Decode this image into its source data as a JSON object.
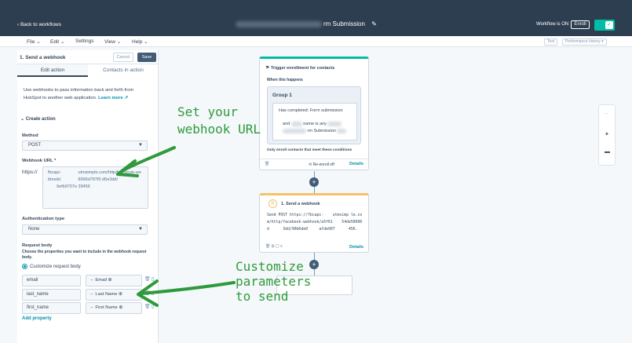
{
  "topbar": {
    "back": "‹ Back to workflows",
    "title": "rm Submission",
    "edit_icon": "✎",
    "status": "Workflow is ON",
    "enroll": "Enroll",
    "toggle_check": "✓"
  },
  "menubar": {
    "file": "File ⌄",
    "edit": "Edit ⌄",
    "settings": "Settings",
    "view": "View ⌄",
    "help": "Help ⌄",
    "test": "Test",
    "performance": "Performance history ▾"
  },
  "panel": {
    "title": "1. Send a webhook",
    "cancel": "Cancel",
    "save": "Save",
    "tab_edit": "Edit action",
    "tab_contacts": "Contacts in action",
    "description": "Use webhooks to pass information back and forth from HubSpot to another web application.",
    "learn_more": "Learn more ↗",
    "create_action": "⌄  Create action",
    "method_label": "Method",
    "method_value": "POST",
    "url_label": "Webhook URL *",
    "url_prefix": "https://",
    "url_value": "fbcapi-    utmsimple.com/http/facebook-webhook/    8996d787f0 d5e3dd/       9efb9707e 39456",
    "auth_label": "Authentication type",
    "auth_value": "None",
    "request_body_label": "Request body",
    "request_body_hint": "Choose the properties you want to include in the webhook request body.",
    "customize_label": "Customize request body",
    "rows": [
      {
        "key": "email",
        "value": "⇔ Email ⊕"
      },
      {
        "key": "last_name",
        "value": "⇔ Last Name ⊕"
      },
      {
        "key": "first_name",
        "value": "⇔ First Name ⊕"
      }
    ],
    "add_property": "Add property"
  },
  "trigger": {
    "heading": "Trigger enrollment for contacts",
    "when": "When this happens",
    "group_title": "Group 1",
    "condition": "Has completed: Form submission",
    "condition2_a": "and",
    "condition2_b": "name is any",
    "condition2_c": "rm Submission",
    "only_enroll": "Only enroll contacts that meet these conditions",
    "re_enroll": "⟲ Re-enroll off",
    "details": "Details"
  },
  "action": {
    "icon": "⟩⟩",
    "title": "1. Send a webhook",
    "body": "Send POST https://fbcapi-    utmsimp le.com/http/facebook-webhook/a5f61    54de58996d      3dd/90b6de0     afde997      456.",
    "details": "Details",
    "footer_icons": "🗑 ⧉ ◯ ⊘"
  },
  "annotations": {
    "set_url": "Set your\nwebhook URL",
    "customize": "Customize\nparameters\nto send"
  },
  "colors": {
    "topbar": "#2d3e50",
    "accent_green": "#2e9a3c",
    "toggle": "#00bda5",
    "link": "#0091ae"
  }
}
